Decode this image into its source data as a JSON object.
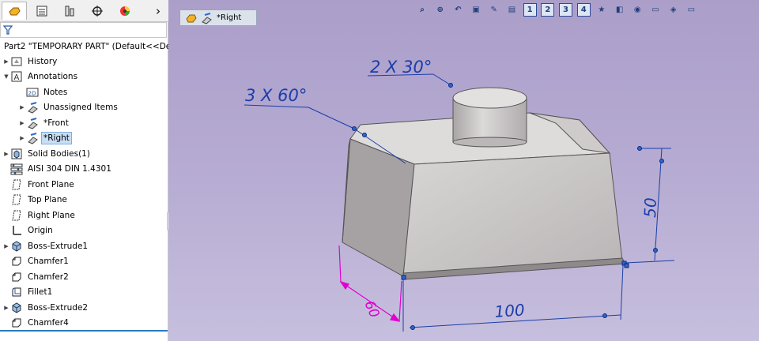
{
  "tabs": [
    {
      "icon": "feature-manager-icon",
      "active": true
    },
    {
      "icon": "property-manager-icon",
      "active": false
    },
    {
      "icon": "configuration-manager-icon",
      "active": false
    },
    {
      "icon": "dimxpert-manager-icon",
      "active": false
    },
    {
      "icon": "display-manager-icon",
      "active": false
    }
  ],
  "tabs_more": "›",
  "part_title": "Part2 \"TEMPORARY PART\" (Default<<De",
  "tree": [
    {
      "label": "History",
      "icon": "history-icon",
      "arrow": true,
      "indent": 0
    },
    {
      "label": "Annotations",
      "icon": "annotations-icon",
      "arrow": "open",
      "indent": 0
    },
    {
      "label": "Notes",
      "icon": "notes-icon",
      "arrow": false,
      "indent": 1
    },
    {
      "label": "Unassigned Items",
      "icon": "view-annotation-icon",
      "arrow": true,
      "indent": 1
    },
    {
      "label": "*Front",
      "icon": "view-annotation-icon",
      "arrow": true,
      "indent": 1
    },
    {
      "label": "*Right",
      "icon": "view-annotation-icon",
      "arrow": true,
      "indent": 1,
      "selected": true
    },
    {
      "label": "Solid Bodies(1)",
      "icon": "solid-bodies-icon",
      "arrow": true,
      "indent": 0
    },
    {
      "label": "AISI 304 DIN 1.4301",
      "icon": "material-icon",
      "arrow": false,
      "indent": 0
    },
    {
      "label": "Front Plane",
      "icon": "plane-icon",
      "arrow": false,
      "indent": 0
    },
    {
      "label": "Top Plane",
      "icon": "plane-icon",
      "arrow": false,
      "indent": 0
    },
    {
      "label": "Right Plane",
      "icon": "plane-icon",
      "arrow": false,
      "indent": 0
    },
    {
      "label": "Origin",
      "icon": "origin-icon",
      "arrow": false,
      "indent": 0
    },
    {
      "label": "Boss-Extrude1",
      "icon": "extrude-icon",
      "arrow": true,
      "indent": 0
    },
    {
      "label": "Chamfer1",
      "icon": "chamfer-icon",
      "arrow": false,
      "indent": 0
    },
    {
      "label": "Chamfer2",
      "icon": "chamfer-icon",
      "arrow": false,
      "indent": 0
    },
    {
      "label": "Fillet1",
      "icon": "fillet-icon",
      "arrow": false,
      "indent": 0
    },
    {
      "label": "Boss-Extrude2",
      "icon": "extrude-icon",
      "arrow": true,
      "indent": 0
    },
    {
      "label": "Chamfer4",
      "icon": "chamfer-icon",
      "arrow": false,
      "indent": 0
    }
  ],
  "view_tab": "*Right",
  "view_toolbar": [
    "zoom-to-fit-icon",
    "zoom-to-area-icon",
    "previous-view-icon",
    "section-view-icon",
    "dynamic-annotation-icon",
    "view-orientation-icon",
    "view-1-icon",
    "view-2-icon",
    "view-3-icon",
    "view-4-icon",
    "view-selector-icon",
    "display-style-icon",
    "hide-show-icon",
    "monitor-icon",
    "appearance-icon",
    "monitor2-icon"
  ],
  "view_toolbar_labels": {
    "view-1-icon": "1",
    "view-2-icon": "2",
    "view-3-icon": "3",
    "view-4-icon": "4"
  },
  "annotations": {
    "chamfer_small": "2 X 30°",
    "chamfer_large": "3 X 60°",
    "dim_height": "50",
    "dim_length": "100",
    "dim_depth": "60"
  },
  "colors": {
    "viewport_top": "#ab9fca",
    "annotation_blue": "#1b3ea8",
    "dim_magenta": "#e000d0",
    "selection": "#c7def5"
  }
}
